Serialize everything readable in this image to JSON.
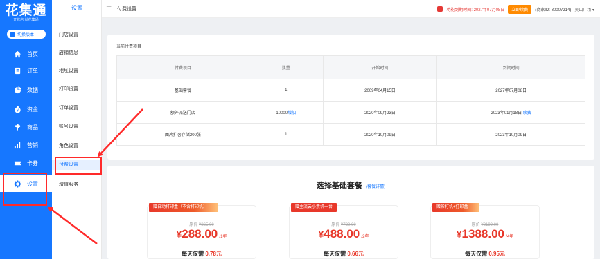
{
  "sidebar": {
    "logo": "花集通",
    "logo_sub": "开花店 就花集通",
    "version_toggle": "切换版本",
    "items": [
      {
        "label": "首页",
        "icon": "home-icon"
      },
      {
        "label": "订单",
        "icon": "order-icon"
      },
      {
        "label": "数据",
        "icon": "chart-icon"
      },
      {
        "label": "资金",
        "icon": "money-icon"
      },
      {
        "label": "商品",
        "icon": "product-icon"
      },
      {
        "label": "营销",
        "icon": "marketing-icon"
      },
      {
        "label": "卡券",
        "icon": "coupon-icon"
      },
      {
        "label": "设置",
        "icon": "gear-icon",
        "active": true
      }
    ]
  },
  "submenu": {
    "title": "设置",
    "items": [
      "门店设置",
      "店铺信息",
      "地址设置",
      "打印设置",
      "订单设置",
      "账号设置",
      "角色设置",
      "付费设置",
      "增值服务"
    ],
    "active_index": 7
  },
  "header": {
    "title": "付费设置",
    "expire_text": "功能到期时间: 2027年07月08日",
    "renew_label": "立即续费",
    "shop_id": "(商家ID: 80007214)",
    "shop_name": "吴山广场 ▾"
  },
  "current_items": {
    "label": "当前付费项目",
    "columns": [
      "付费项目",
      "数量",
      "开始时间",
      "到期时间"
    ],
    "rows": [
      {
        "name": "基础套餐",
        "qty": "1",
        "qty_link": "",
        "start": "2009年04月15日",
        "end": "2027年07月08日",
        "end_link": ""
      },
      {
        "name": "额外派送门店",
        "qty": "10000",
        "qty_link": "增加",
        "start": "2020年09月23日",
        "end": "2023年01月18日",
        "end_link": "续费"
      },
      {
        "name": "图片扩容存储200张",
        "qty": "1",
        "qty_link": "",
        "start": "2020年10月09日",
        "end": "2023年10月09日",
        "end_link": ""
      }
    ]
  },
  "plans": {
    "title": "选择基础套餐",
    "detail_link": "(套餐详情)",
    "packages": [
      {
        "tag": "赠自动打印盒（不含打印机）",
        "orig_label": "原价",
        "orig_price": "¥365.00",
        "currency": "¥",
        "price": "288.00",
        "period": "/1年",
        "daily_label": "每天仅需",
        "daily_price": "0.78元"
      },
      {
        "tag": "赠主流云小票机一台",
        "orig_label": "原价",
        "orig_price": "¥730.00",
        "currency": "¥",
        "price": "488.00",
        "period": "/2年",
        "daily_label": "每天仅需",
        "daily_price": "0.66元"
      },
      {
        "tag": "赠彩打机+打印盒",
        "orig_label": "原价",
        "orig_price": "¥2199.00",
        "currency": "¥",
        "price": "1388.00",
        "period": "/4年",
        "daily_label": "每天仅需",
        "daily_price": "0.95元"
      }
    ]
  },
  "colors": {
    "brand": "#1677ff",
    "price_red": "#e8382a",
    "renew_orange": "#ff8a00",
    "annotation_red": "#ff2a2a"
  }
}
